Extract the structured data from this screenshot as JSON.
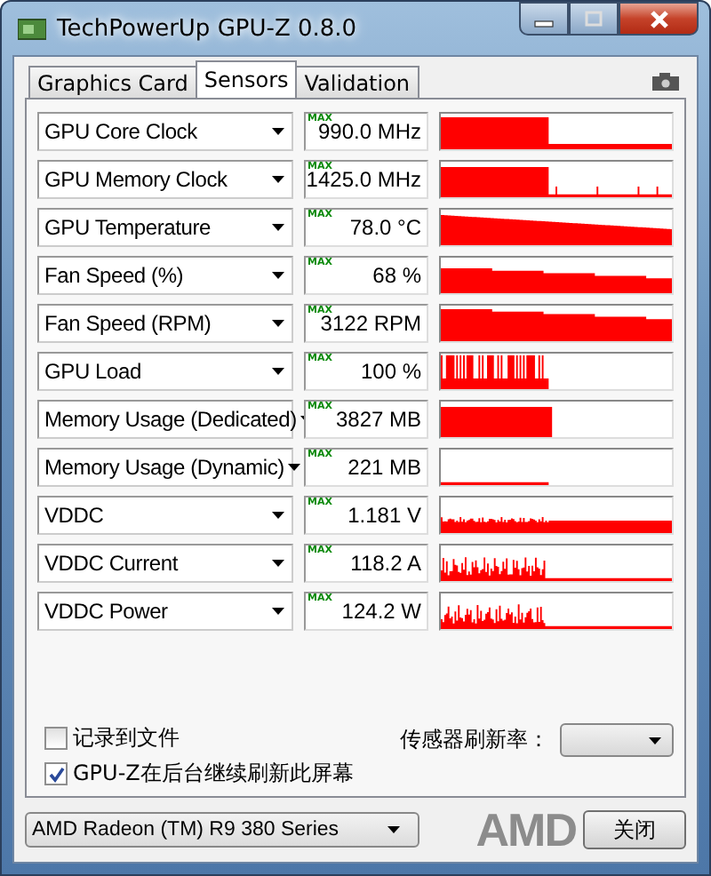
{
  "window": {
    "title": "TechPowerUp GPU-Z 0.8.0"
  },
  "tabs": [
    {
      "label": "Graphics Card",
      "selected": false
    },
    {
      "label": "Sensors",
      "selected": true
    },
    {
      "label": "Validation",
      "selected": false
    }
  ],
  "sensors": [
    {
      "name": "GPU Core Clock",
      "value": "990.0 MHz",
      "max_tag": "MAX"
    },
    {
      "name": "GPU Memory Clock",
      "value": "1425.0 MHz",
      "max_tag": "MAX"
    },
    {
      "name": "GPU Temperature",
      "value": "78.0 °C",
      "max_tag": "MAX"
    },
    {
      "name": "Fan Speed (%)",
      "value": "68 %",
      "max_tag": "MAX"
    },
    {
      "name": "Fan Speed (RPM)",
      "value": "3122 RPM",
      "max_tag": "MAX"
    },
    {
      "name": "GPU Load",
      "value": "100 %",
      "max_tag": "MAX"
    },
    {
      "name": "Memory Usage (Dedicated)",
      "value": "3827 MB",
      "max_tag": "MAX"
    },
    {
      "name": "Memory Usage (Dynamic)",
      "value": "221 MB",
      "max_tag": "MAX"
    },
    {
      "name": "VDDC",
      "value": "1.181 V",
      "max_tag": "MAX"
    },
    {
      "name": "VDDC Current",
      "value": "118.2 A",
      "max_tag": "MAX"
    },
    {
      "name": "VDDC Power",
      "value": "124.2 W",
      "max_tag": "MAX"
    }
  ],
  "options": [
    {
      "label": "记录到文件",
      "checked": false
    },
    {
      "label": "GPU-Z在后台继续刷新此屏幕",
      "checked": true
    }
  ],
  "refresh_rate": {
    "label": "传感器刷新率："
  },
  "gpu_select": {
    "value": "AMD Radeon (TM) R9 380 Series"
  },
  "logo": "AMD",
  "close_button": "关闭"
}
